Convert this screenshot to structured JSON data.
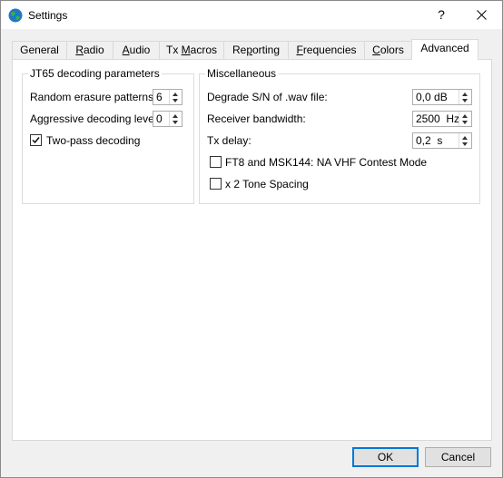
{
  "window": {
    "title": "Settings",
    "help_label": "?"
  },
  "tabs": [
    {
      "label_pre": "General",
      "label_ul": "",
      "label_post": ""
    },
    {
      "label_pre": "",
      "label_ul": "R",
      "label_post": "adio"
    },
    {
      "label_pre": "",
      "label_ul": "A",
      "label_post": "udio"
    },
    {
      "label_pre": "Tx ",
      "label_ul": "M",
      "label_post": "acros"
    },
    {
      "label_pre": "Re",
      "label_ul": "p",
      "label_post": "orting"
    },
    {
      "label_pre": "",
      "label_ul": "F",
      "label_post": "requencies"
    },
    {
      "label_pre": "",
      "label_ul": "C",
      "label_post": "olors"
    },
    {
      "label_pre": "Advanced",
      "label_ul": "",
      "label_post": ""
    }
  ],
  "jt65": {
    "title": "JT65 decoding parameters",
    "erasure_label": "Random erasure patterns:",
    "erasure_value": "6",
    "aggressive_label": "Aggressive decoding level:",
    "aggressive_value": "0",
    "twopass_label": "Two-pass decoding",
    "twopass_checked": true
  },
  "misc": {
    "title": "Miscellaneous",
    "degrade_label": "Degrade S/N of .wav file:",
    "degrade_value": "0,0 dB",
    "bandwidth_label": "Receiver bandwidth:",
    "bandwidth_value": "2500  Hz",
    "txdelay_label": "Tx delay:",
    "txdelay_value": "0,2  s",
    "ft8_label": "FT8 and MSK144:  NA VHF Contest Mode",
    "ft8_checked": false,
    "tone_label": "x 2 Tone Spacing",
    "tone_checked": false
  },
  "footer": {
    "ok_label": "OK",
    "cancel_label": "Cancel"
  }
}
